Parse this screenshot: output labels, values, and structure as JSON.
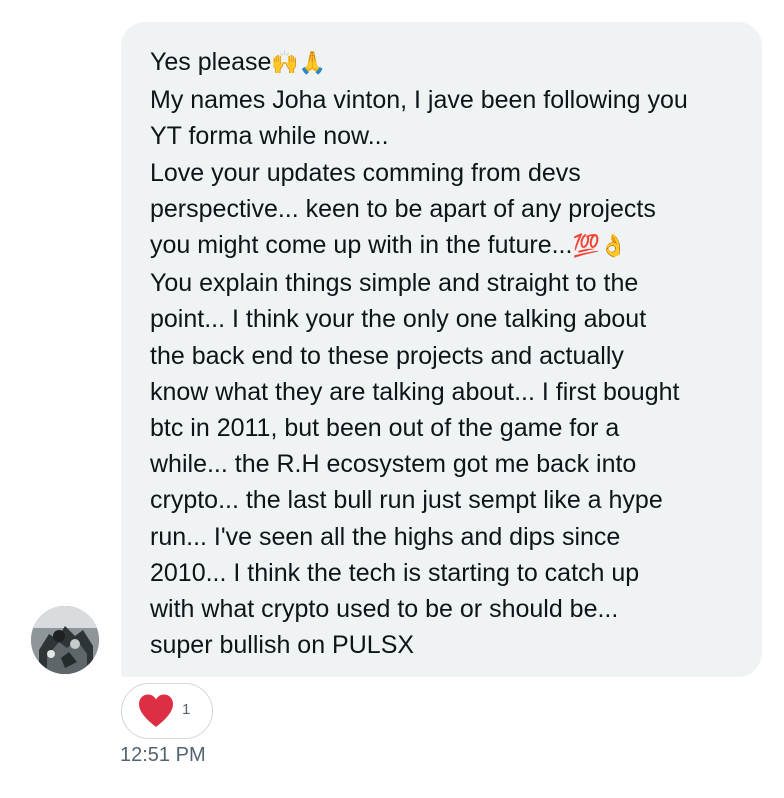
{
  "message": {
    "lines": [
      {
        "text": "Yes please",
        "emoji": "🙌🙏"
      },
      {
        "text": "My names Joha vinton, I jave been following you"
      },
      {
        "text": "YT forma while now..."
      },
      {
        "text": "Love your updates comming from devs"
      },
      {
        "text": "perspective... keen to be apart of any projects"
      },
      {
        "text": "you might come up with in the future...",
        "emoji": "💯👌"
      },
      {
        "text": "You explain things simple and straight to the"
      },
      {
        "text": "point... I think your the only one talking about"
      },
      {
        "text": "the back end to these projects and actually"
      },
      {
        "text": "know what they are talking about... I first bought"
      },
      {
        "text": "btc in 2011, but been out of the game for a"
      },
      {
        "text": "while... the R.H ecosystem got me back into"
      },
      {
        "text": "crypto... the last bull run just sempt like a hype"
      },
      {
        "text": "run... I've seen all the highs and dips since"
      },
      {
        "text": "2010... I think the tech is starting to catch up"
      },
      {
        "text": "with what crypto used to be or should be..."
      },
      {
        "text": "super bullish on PULSX"
      }
    ]
  },
  "reaction": {
    "icon": "heart-icon",
    "count": "1",
    "color": "#e0245e"
  },
  "timestamp": "12:51 PM",
  "colors": {
    "bubble_bg": "#eff3f4",
    "text": "#0f1419",
    "secondary_text": "#536471",
    "reaction_border": "#cfd9de"
  }
}
